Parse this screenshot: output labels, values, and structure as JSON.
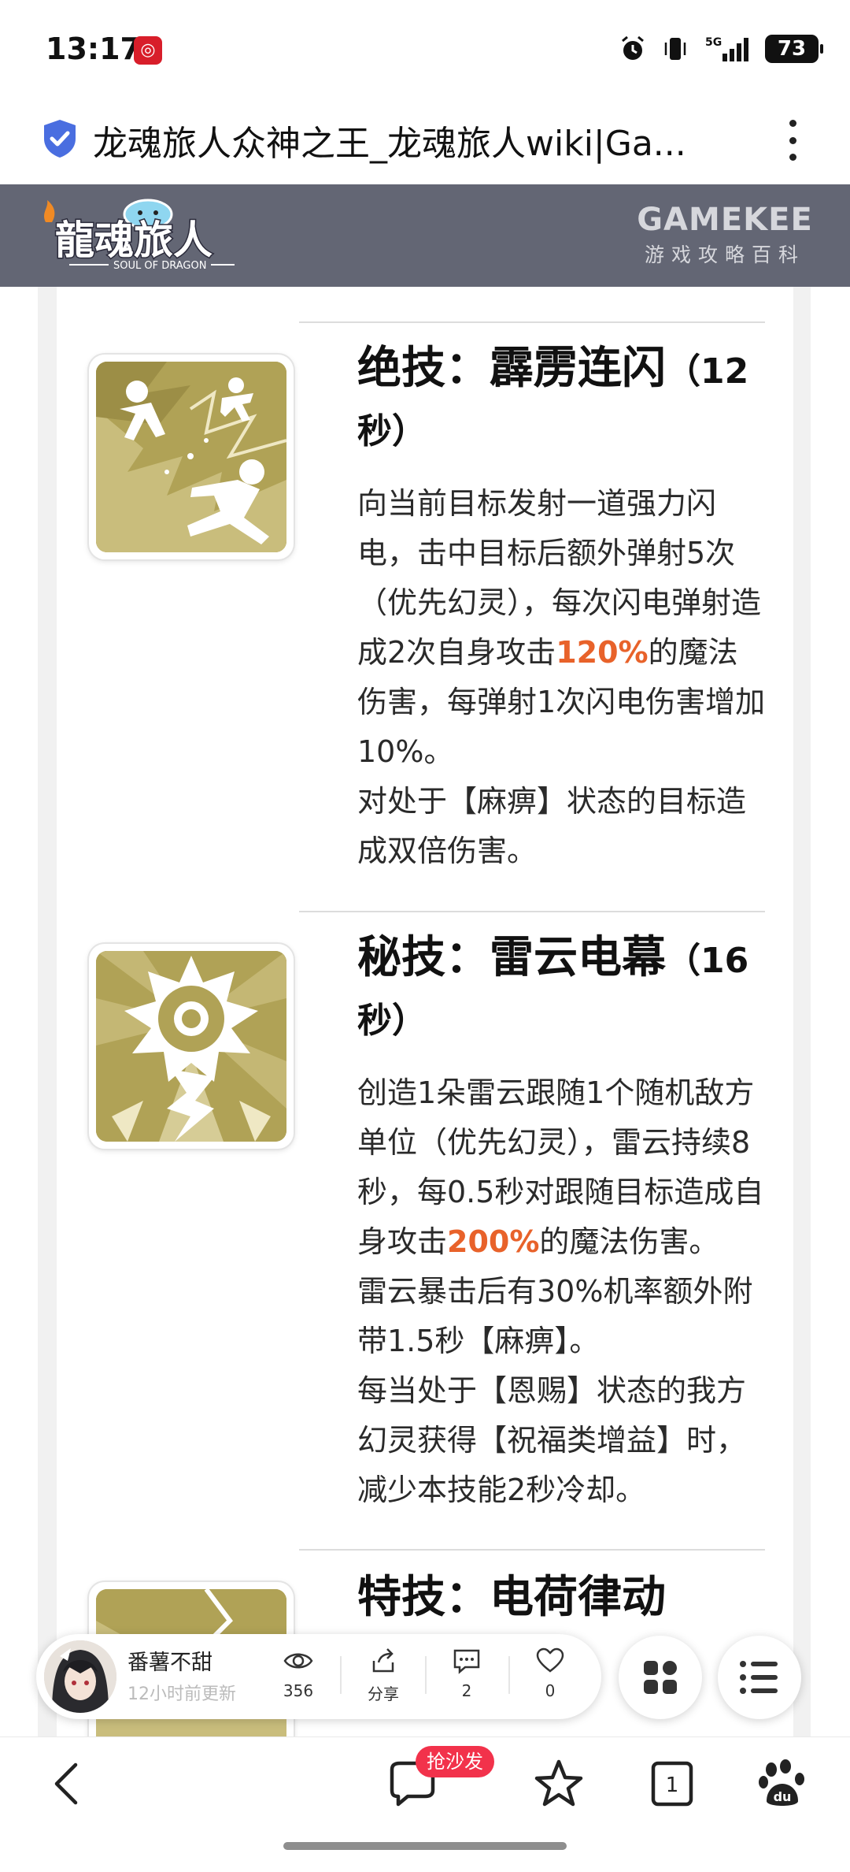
{
  "status_bar": {
    "time": "13:17",
    "network": "5G",
    "battery": "73"
  },
  "browser": {
    "page_title": "龙魂旅人众神之王_龙魂旅人wiki|Ga..."
  },
  "header": {
    "logo_title": "龍魂旅人",
    "logo_sub": "SOUL OF DRAGON",
    "brand": "GAMEKEE",
    "brand_sub": "游戏攻略百科"
  },
  "skills": [
    {
      "title": "绝技：霹雳连闪",
      "cooldown": "（12秒）",
      "icon": "lightning-chain-icon",
      "desc": {
        "a1": "向当前目标发射一道强力闪电，击中目标后额外弹射5次（优先幻灵），每次闪电弹射造成2次自身攻击",
        "hl": "120%",
        "a2": "的魔法伤害，每弹射1次闪电伤害增加10%。",
        "b": "对处于【麻痹】状态的目标造成双倍伤害。"
      }
    },
    {
      "title": "秘技：雷云电幕",
      "cooldown": "（16秒）",
      "icon": "thunder-cloud-icon",
      "desc": {
        "a1": "创造1朵雷云跟随1个随机敌方单位（优先幻灵），雷云持续8秒，每0.5秒对跟随目标造成自身攻击",
        "hl": "200%",
        "a2": "的魔法伤害。",
        "b": "雷云暴击后有30%机率额外附带1.5秒【麻痹】。",
        "c": "每当处于【恩赐】状态的我方幻灵获得【祝福类增益】时，减少本技能2秒冷却。"
      }
    },
    {
      "title": "特技：电荷律动",
      "icon": "charge-rhythm-icon"
    }
  ],
  "author_bar": {
    "name": "番薯不甜",
    "updated": "12小时前更新",
    "views": "356",
    "share_label": "分享",
    "comments": "2",
    "likes": "0"
  },
  "bottom_nav": {
    "sofa_badge": "抢沙发",
    "tabs_count": "1"
  },
  "colors": {
    "header_bg": "#636674",
    "highlight": "#e8622a",
    "icon_gold": "#b0a256",
    "badge_red": "#f2324b",
    "shield_blue": "#4a6ee0"
  }
}
